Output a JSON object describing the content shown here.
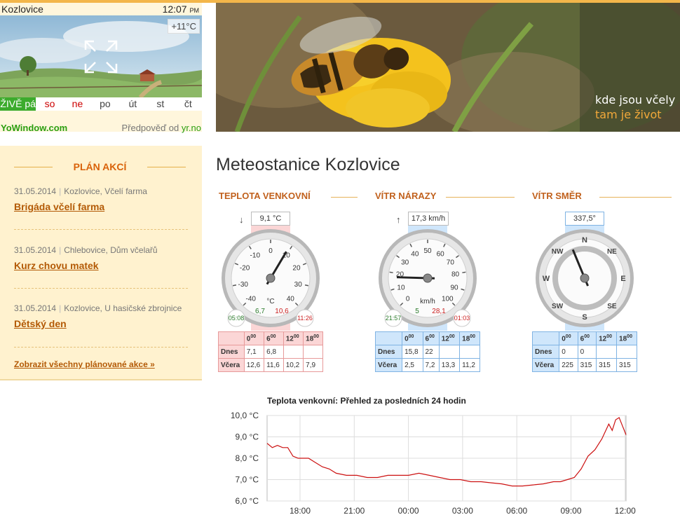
{
  "widget": {
    "city": "Kozlovice",
    "time": "12:07",
    "ampm": "PM",
    "temperature": "+11°C",
    "days": [
      "ŽIVĚ pá",
      "so",
      "ne",
      "po",
      "út",
      "st",
      "čt"
    ],
    "brand": "YoWindow.com",
    "forecast_prefix": "Předpověď od",
    "forecast_source": "yr.no"
  },
  "banner": {
    "line1": "kde jsou včely",
    "line2": "tam je život"
  },
  "events": {
    "title": "PLÁN AKCÍ",
    "items": [
      {
        "date": "31.05.2014",
        "place": "Kozlovice, Včelí farma",
        "name": "Brigáda včelí farma"
      },
      {
        "date": "31.05.2014",
        "place": "Chlebovice, Dům včelařů",
        "name": "Kurz chovu matek"
      },
      {
        "date": "31.05.2014",
        "place": "Kozlovice, U hasičské zbrojnice",
        "name": "Dětský den"
      }
    ],
    "all_link": "Zobrazit všechny plánované akce »"
  },
  "main": {
    "title": "Meteostanice Kozlovice"
  },
  "gauges": [
    {
      "title": "TEPLOTA VENKOVNÍ",
      "tag": "9,1 °C",
      "trend": "↓",
      "unit": "°C",
      "value": 9.1,
      "scale": [
        "-40",
        "-30",
        "-20",
        "-10",
        "0",
        "10",
        "20",
        "30",
        "40"
      ],
      "low": "6,7",
      "high": "10,6",
      "low_time": "05:08",
      "high_time": "11:26",
      "table": {
        "headers": [
          "0",
          "6",
          "12",
          "18"
        ],
        "rows": [
          {
            "label": "Dnes",
            "values": [
              "7,1",
              "6,8",
              "",
              ""
            ]
          },
          {
            "label": "Včera",
            "values": [
              "12,6",
              "11,6",
              "10,2",
              "7,9"
            ]
          }
        ]
      }
    },
    {
      "title": "VÍTR NÁRAZY",
      "tag": "17,3 km/h",
      "trend": "↑",
      "unit": "km/h",
      "value": 17.3,
      "scale": [
        "0",
        "10",
        "20",
        "30",
        "40",
        "50",
        "60",
        "70",
        "80",
        "90",
        "100"
      ],
      "low": "5",
      "high": "28,1",
      "low_time": "21:57",
      "high_time": "01:03",
      "table": {
        "headers": [
          "0",
          "6",
          "12",
          "18"
        ],
        "rows": [
          {
            "label": "Dnes",
            "values": [
              "15,8",
              "22",
              "",
              ""
            ]
          },
          {
            "label": "Včera",
            "values": [
              "2,5",
              "7,2",
              "13,3",
              "11,2"
            ]
          }
        ]
      }
    },
    {
      "title": "VÍTR SMĚR",
      "tag": "337,5°",
      "value": 337.5,
      "scale": [
        "N",
        "NE",
        "E",
        "SE",
        "S",
        "SW",
        "W",
        "NW"
      ],
      "table": {
        "headers": [
          "0",
          "6",
          "12",
          "18"
        ],
        "rows": [
          {
            "label": "Dnes",
            "values": [
              "0",
              "0",
              "",
              ""
            ]
          },
          {
            "label": "Včera",
            "values": [
              "225",
              "315",
              "315",
              "315"
            ]
          }
        ]
      }
    }
  ],
  "colors": {
    "accent": "#c1611d",
    "temp": "#fbd6d6",
    "wind": "#cfe6fb",
    "live": "#3cab2d",
    "line": "#cc1111"
  },
  "chart_data": {
    "type": "line",
    "title": "Teplota venkovní: Přehled za posledních 24 hodin",
    "x_ticks": [
      "18:00",
      "21:00",
      "00:00",
      "03:00",
      "06:00",
      "09:00",
      "12:00"
    ],
    "y_ticks": [
      "10,0 °C",
      "9,0 °C",
      "8,0 °C",
      "7,0 °C",
      "6,0 °C"
    ],
    "ylim": [
      6.0,
      10.0
    ],
    "x_unit": "hours since 16:12",
    "series": [
      {
        "x": [
          0,
          0.3,
          0.6,
          0.9,
          1.2,
          1.5,
          1.8,
          2.0,
          2.4,
          2.8,
          3.2,
          3.6,
          4.0,
          4.6,
          5.2,
          5.8,
          6.4,
          7.0,
          7.6,
          8.2,
          8.8,
          9.4,
          10.0,
          10.6,
          11.2,
          11.8,
          12.4,
          13.0,
          13.6,
          14.2,
          14.8,
          15.4,
          16.0,
          16.6,
          17.0,
          17.4,
          17.8,
          18.2,
          18.6,
          19.0,
          19.4,
          19.8,
          20.0,
          20.2,
          20.4,
          20.6,
          20.8
        ],
        "values": [
          8.7,
          8.5,
          8.6,
          8.5,
          8.5,
          8.1,
          8.0,
          8.0,
          8.0,
          7.8,
          7.6,
          7.5,
          7.3,
          7.2,
          7.2,
          7.1,
          7.1,
          7.2,
          7.2,
          7.2,
          7.3,
          7.2,
          7.1,
          7.0,
          7.0,
          6.9,
          6.9,
          6.85,
          6.8,
          6.7,
          6.7,
          6.75,
          6.8,
          6.9,
          6.9,
          7.0,
          7.1,
          7.5,
          8.1,
          8.4,
          8.9,
          9.6,
          9.3,
          9.8,
          9.9,
          9.5,
          9.1
        ]
      }
    ]
  }
}
